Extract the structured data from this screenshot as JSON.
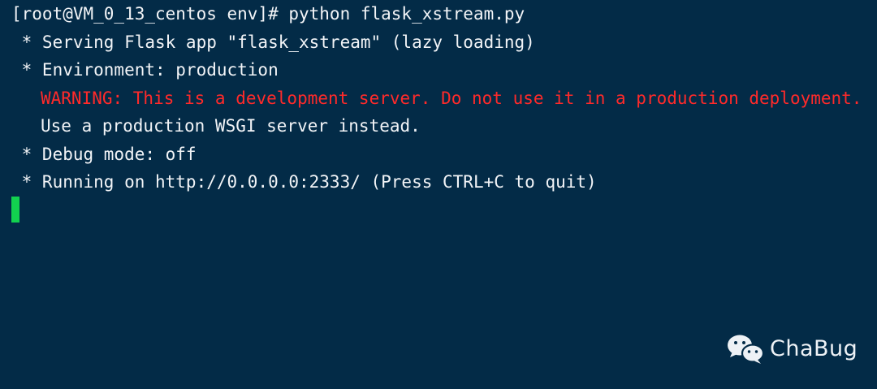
{
  "colors": {
    "background": "#032b47",
    "text": "#f2f4f7",
    "warning": "#ff2a2a",
    "cursor": "#12d14f"
  },
  "terminal": {
    "prompt_command": "[root@VM_0_13_centos env]# python flask_xstream.py",
    "lines": [
      " * Serving Flask app \"flask_xstream\" (lazy loading)",
      " * Environment: production",
      "WARNING: This is a development server. Do not use it in a production deployment.",
      "Use a production WSGI server instead.",
      " * Debug mode: off",
      " * Running on http://0.0.0.0:2333/ (Press CTRL+C to quit)"
    ]
  },
  "watermark": {
    "icon": "wechat-icon",
    "text": "ChaBug"
  }
}
